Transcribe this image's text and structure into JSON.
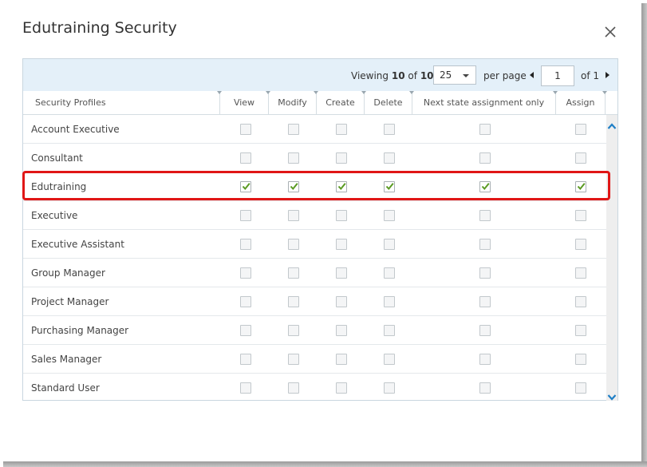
{
  "dialog": {
    "title": "Edutraining Security"
  },
  "pager": {
    "viewing_prefix": "Viewing",
    "viewing_count": "10",
    "viewing_of": "of",
    "viewing_total": "10",
    "page_size": "25",
    "per_page_label": "per page",
    "current_page": "1",
    "of_pages": "of 1"
  },
  "columns": [
    "Security Profiles",
    "View",
    "Modify",
    "Create",
    "Delete",
    "Next state assignment only",
    "Assign"
  ],
  "rows": [
    {
      "name": "Account Executive",
      "view": false,
      "modify": false,
      "create": false,
      "delete": false,
      "next_state": false,
      "assign": false
    },
    {
      "name": "Consultant",
      "view": false,
      "modify": false,
      "create": false,
      "delete": false,
      "next_state": false,
      "assign": false
    },
    {
      "name": "Edutraining",
      "view": true,
      "modify": true,
      "create": true,
      "delete": true,
      "next_state": true,
      "assign": true
    },
    {
      "name": "Executive",
      "view": false,
      "modify": false,
      "create": false,
      "delete": false,
      "next_state": false,
      "assign": false
    },
    {
      "name": "Executive Assistant",
      "view": false,
      "modify": false,
      "create": false,
      "delete": false,
      "next_state": false,
      "assign": false
    },
    {
      "name": "Group Manager",
      "view": false,
      "modify": false,
      "create": false,
      "delete": false,
      "next_state": false,
      "assign": false
    },
    {
      "name": "Project Manager",
      "view": false,
      "modify": false,
      "create": false,
      "delete": false,
      "next_state": false,
      "assign": false
    },
    {
      "name": "Purchasing Manager",
      "view": false,
      "modify": false,
      "create": false,
      "delete": false,
      "next_state": false,
      "assign": false
    },
    {
      "name": "Sales Manager",
      "view": false,
      "modify": false,
      "create": false,
      "delete": false,
      "next_state": false,
      "assign": false
    },
    {
      "name": "Standard User",
      "view": false,
      "modify": false,
      "create": false,
      "delete": false,
      "next_state": false,
      "assign": false
    }
  ],
  "colors": {
    "check": "#5a9a22",
    "highlight": "#e01616",
    "scroll_arrow": "#1f7fc6"
  },
  "icons": {
    "close": "close-icon",
    "check": "checkmark-icon",
    "prev": "caret-left-icon",
    "next": "caret-right-icon",
    "scroll_up": "chevron-up-icon",
    "scroll_down": "chevron-down-icon"
  }
}
